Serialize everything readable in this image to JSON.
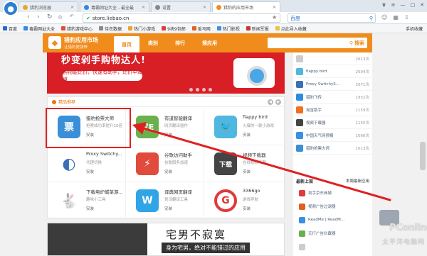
{
  "browser": {
    "tabs": [
      {
        "label": "猎豹浏览器",
        "color": "#e8a532"
      },
      {
        "label": "毒霸网址大全 - 最全最",
        "color": "#2e8be0"
      },
      {
        "label": "设置",
        "color": "#888888"
      },
      {
        "label": "猎豹的应用市场",
        "color": "#f08c1c"
      }
    ],
    "url": "store.liebao.cn",
    "search_provider": "百度",
    "bookmarks": [
      {
        "label": "百度",
        "color": "#2b66d8"
      },
      {
        "label": "毒霸网址大全",
        "color": "#2e8be0"
      },
      {
        "label": "猎豹游戏中心",
        "color": "#e34d2f"
      },
      {
        "label": "侍衣数据",
        "color": "#888888"
      },
      {
        "label": "热门小游戏",
        "color": "#f0a030"
      },
      {
        "label": "9块9包邮",
        "color": "#e03a3a"
      },
      {
        "label": "爱马网",
        "color": "#e06020"
      },
      {
        "label": "热门影视",
        "color": "#3a8ee6"
      },
      {
        "label": "新闻军报",
        "color": "#cc3333"
      },
      {
        "label": "点此导入收藏",
        "color": "#f0c040"
      }
    ],
    "bookmarks_right": "手机收藏"
  },
  "app": {
    "title": "猎豹应用市场",
    "subtitle": "让猎豹更强悍",
    "nav": [
      "首页",
      "类别",
      "排行",
      "搜应用"
    ],
    "search_label": "搜索"
  },
  "banner": {
    "headline": "秒变剁手购物达人!",
    "sub": "购物能比价，快速有助手，比价早知道"
  },
  "featured": {
    "heading": "精品推荐",
    "install_label": "安装",
    "apps": [
      {
        "name": "猎豹抢票大师",
        "desc": "抢票成功率提升10倍",
        "icon": "票",
        "color": "#3b8ed8"
      },
      {
        "name": "有道智能翻译",
        "desc": "网页翻译插件",
        "icon": "汉E",
        "color": "#6ab04c"
      },
      {
        "name": "flappy bird",
        "desc": "火爆的一款小游戏",
        "icon": "🐦",
        "color": "#4fb7e0"
      },
      {
        "name": "Proxy Switchy...",
        "desc": "代理切换",
        "icon": "◐",
        "color": "#3c6fb5"
      },
      {
        "name": "谷歌访问助手",
        "desc": "谷歌服务加速",
        "icon": "⚡",
        "color": "#e14b3b"
      },
      {
        "name": "视频下载器",
        "desc": "在线视频下载",
        "icon": "下载",
        "color": "#444444"
      },
      {
        "name": "下载电炉城菜游...",
        "desc": "趣味小工具",
        "icon": "🐇",
        "color": "#c9a070"
      },
      {
        "name": "译典网页翻译",
        "desc": "划词翻译工具",
        "icon": "W",
        "color": "#2fa5e6"
      },
      {
        "name": "3366go",
        "desc": "游戏导航",
        "icon": "G",
        "color": "#e03a3a"
      }
    ]
  },
  "banner2": {
    "title": "宅男不寂寞",
    "sub": "身为宅男，绝对不能错过的应用"
  },
  "ranking": {
    "items": [
      {
        "name": "",
        "count": "2613次",
        "color": "#cccccc"
      },
      {
        "name": "flappy bird",
        "count": "2604次",
        "color": "#4fb7e0"
      },
      {
        "name": "Proxy SwitchyS...",
        "count": "2071次",
        "color": "#3c6fb5"
      },
      {
        "name": "猎豹飞传",
        "count": "1952次",
        "color": "#2e8be0"
      },
      {
        "name": "淘宝助手",
        "count": "1159次",
        "color": "#f07020"
      },
      {
        "name": "视频下载器",
        "count": "1155次",
        "color": "#444444"
      },
      {
        "name": "中国天气网预报",
        "count": "1066次",
        "color": "#3a8ee6"
      },
      {
        "name": "猎豹抢票大师",
        "count": "1013次",
        "color": "#3b8ed8"
      }
    ],
    "section2_title": "最新上架",
    "section2_more": "本周最新应用",
    "section2_items": [
      {
        "name": "到手京东商城",
        "color": "#e03a3a"
      },
      {
        "name": "视频广告过滤器",
        "color": "#e06020"
      },
      {
        "name": "ReadMe | ReadM...",
        "color": "#3a8ee6"
      },
      {
        "name": "天行广告拦截器",
        "color": "#6ab04c"
      },
      {
        "name": "",
        "color": "#cccccc"
      }
    ]
  },
  "watermark": {
    "brand": "PConline",
    "sub": "太平洋电脑网"
  }
}
